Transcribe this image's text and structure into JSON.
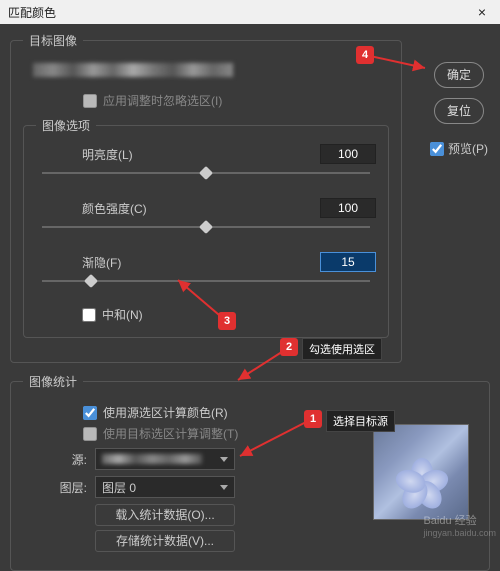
{
  "window": {
    "title": "匹配颜色",
    "close": "×"
  },
  "buttons": {
    "ok": "确定",
    "reset": "复位"
  },
  "preview": {
    "label": "预览(P)",
    "checked": true
  },
  "target": {
    "legend": "目标图像",
    "ignore_selection": {
      "label": "应用调整时忽略选区(I)",
      "checked": false
    }
  },
  "image_options": {
    "legend": "图像选项",
    "brightness": {
      "label": "明亮度(L)",
      "value": "100",
      "pos": 50
    },
    "intensity": {
      "label": "颜色强度(C)",
      "value": "100",
      "pos": 50
    },
    "fade": {
      "label": "渐隐(F)",
      "value": "15",
      "pos": 15
    },
    "neutralize": {
      "label": "中和(N)",
      "checked": false
    }
  },
  "stats": {
    "legend": "图像统计",
    "use_source_selection": {
      "label": "使用源选区计算颜色(R)",
      "checked": true
    },
    "use_target_selection": {
      "label": "使用目标选区计算调整(T)",
      "checked": false
    },
    "source_label": "源:",
    "layer_label": "图层:",
    "layer_value": "图层 0",
    "load_stats": "载入统计数据(O)...",
    "save_stats": "存储统计数据(V)..."
  },
  "annotations": {
    "n1": "1",
    "n2": "2",
    "n3": "3",
    "n4": "4",
    "label_select_source": "选择目标源",
    "label_check_use": "勾选使用选区"
  },
  "watermark": {
    "main": "Baidu 经验",
    "sub": "jingyan.baidu.com"
  }
}
